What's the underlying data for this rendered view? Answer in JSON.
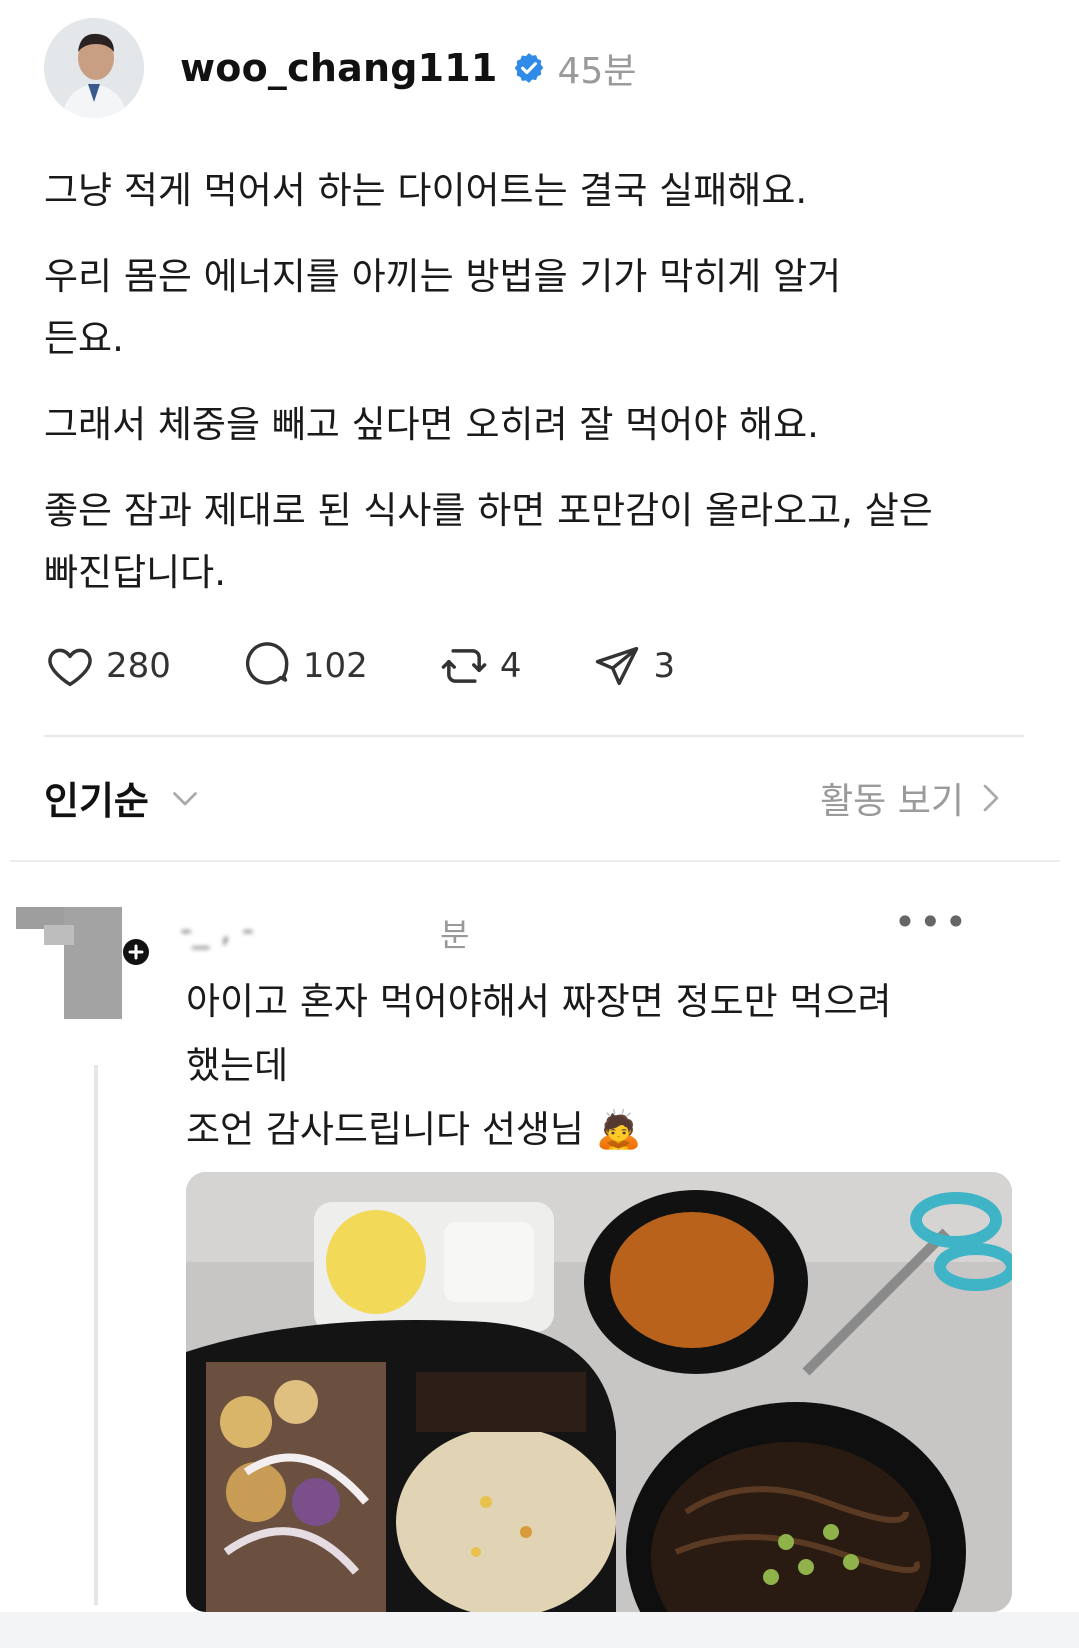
{
  "post": {
    "username": "woo_chang111",
    "time": "45분",
    "paragraphs": [
      "그냥 적게 먹어서 하는 다이어트는 결국 실패해요.",
      "우리 몸은 에너지를 아끼는 방법을 기가 막히게 알거든요.",
      "그래서 체중을 빼고 싶다면 오히려 잘 먹어야 해요.",
      "좋은 잠과 제대로 된 식사를 하면 포만감이 올라오고, 살은 빠진답니다."
    ],
    "like_count": "280",
    "comment_count": "102",
    "repost_count": "4",
    "share_count": "3"
  },
  "sort": {
    "label": "인기순",
    "activity_label": "활동 보기"
  },
  "comment": {
    "username_blurred": "-_  ,  -",
    "time": "분",
    "line1": "아이고 혼자 먹어야해서 짜장면 정도만 먹으려",
    "line2": "했는데",
    "line3": "조언 감사드립니다 선생님 🙇",
    "more_label": "•••"
  },
  "icons": {
    "verified": "verified-badge-icon",
    "like": "heart-icon",
    "comment": "speech-bubble-icon",
    "repost": "repost-icon",
    "share": "paper-plane-icon",
    "sort": "chevron-down-icon",
    "activity": "chevron-right-icon"
  },
  "colors": {
    "verified_blue": "#2f8ae8",
    "muted_text": "#9a9a9a"
  }
}
